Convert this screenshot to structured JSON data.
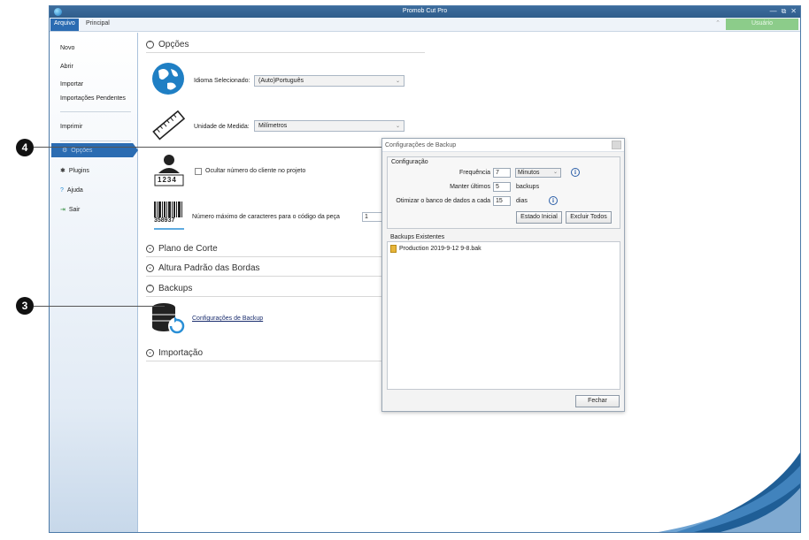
{
  "window": {
    "title": "Promob Cut Pro",
    "controls": [
      "—",
      "⧉",
      "✕"
    ]
  },
  "ribbon": {
    "tabs": [
      "Arquivo",
      "Principal"
    ],
    "user_button": "Usuário",
    "collapse_glyph": "⌃"
  },
  "sidebar": {
    "file_items": [
      "Novo",
      "Abrir",
      "Importar",
      "Importações Pendentes"
    ],
    "print_item": "Imprimir",
    "nav_items": [
      {
        "label": "Opções",
        "icon": "gear-icon",
        "active": true
      },
      {
        "label": "Plugins",
        "icon": "puzzle-icon"
      },
      {
        "label": "Ajuda",
        "icon": "help-icon"
      },
      {
        "label": "Sair",
        "icon": "exit-icon"
      }
    ]
  },
  "options": {
    "title": "Opções",
    "language_label": "Idioma Selecionado:",
    "language_value": "(Auto)Português",
    "unit_label": "Unidade de Medida:",
    "unit_value": "Milímetros",
    "hide_client_label": "Ocultar número do cliente no projeto",
    "client_badge": "1234",
    "max_chars_label": "Número máximo de caracteres para o código da peça",
    "max_chars_value": "1",
    "barcode_number": "358937"
  },
  "sections": {
    "cut_plan": "Plano de Corte",
    "edge_height": "Altura Padrão das Bordas",
    "backups": "Backups",
    "backup_link": "Configurações de Backup",
    "import": "Importação"
  },
  "dialog": {
    "title": "Configurações de Backup",
    "config_group": "Configuração",
    "frequency_label": "Frequência",
    "frequency_value": "7",
    "frequency_unit": "Minutos",
    "keep_label": "Manter últimos",
    "keep_value": "5",
    "keep_unit": "backups",
    "optimize_label": "Otimizar o banco de dados a cada",
    "optimize_value": "15",
    "optimize_unit": "dias",
    "btn_initial": "Estado Inicial",
    "btn_delete_all": "Excluir Todos",
    "existing_group": "Backups Existentes",
    "backups": [
      "Production 2019-9-12 9-8.bak"
    ],
    "close": "Fechar"
  },
  "callouts": {
    "four": "4",
    "three": "3"
  }
}
